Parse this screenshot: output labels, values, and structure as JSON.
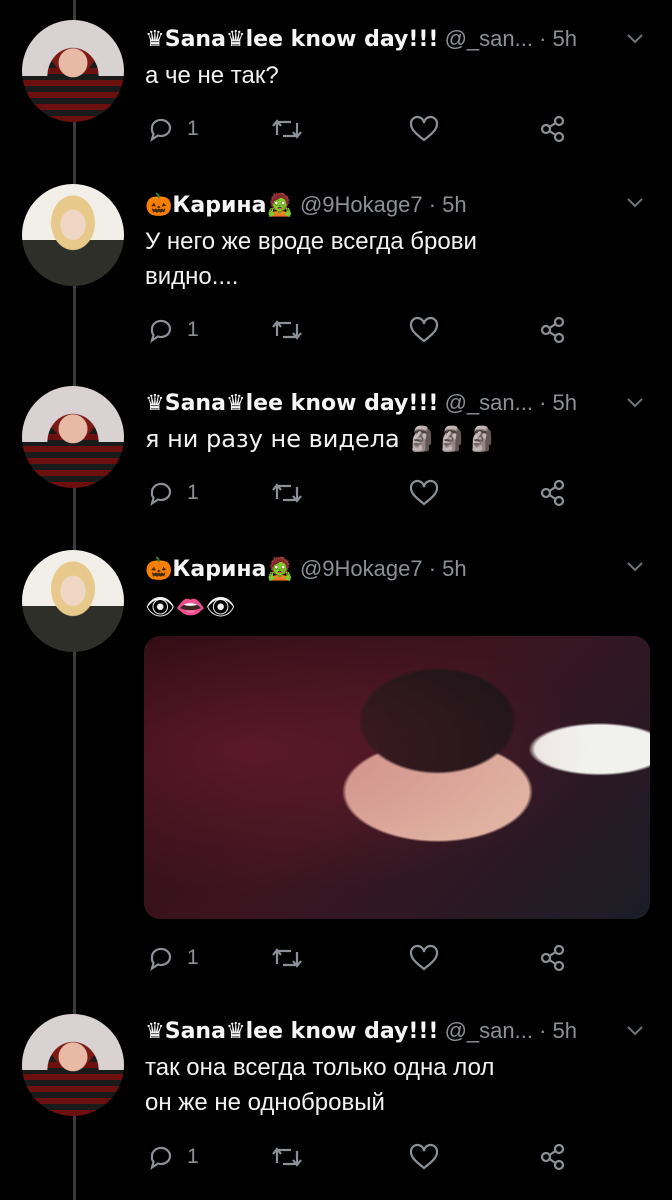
{
  "tweets": [
    {
      "author": "sana",
      "name": "♛Sana♛lee know day!!!",
      "handle": "@_san...",
      "time": "· 5h",
      "text_lines": [
        "а че не так?"
      ],
      "reply_count": "1"
    },
    {
      "author": "karina",
      "name": "🎃Карина🧟",
      "handle": "@9Hokage7",
      "time": "· 5h",
      "text_lines": [
        "У него же вроде всегда брови",
        "видно...."
      ],
      "reply_count": "1"
    },
    {
      "author": "sana",
      "name": "♛Sana♛lee know day!!!",
      "handle": "@_san...",
      "time": "· 5h",
      "text_lines": [
        "я ни разу не видела 🗿🗿🗿"
      ],
      "reply_count": "1"
    },
    {
      "author": "karina",
      "name": "🎃Карина🧟",
      "handle": "@9Hokage7",
      "time": "· 5h",
      "text_lines": [
        "👁👄👁"
      ],
      "reply_count": "1",
      "has_media": true
    },
    {
      "author": "sana",
      "name": "♛Sana♛lee know day!!!",
      "handle": "@_san...",
      "time": "· 5h",
      "text_lines": [
        "так она всегда только одна лол",
        "он же не однобровый"
      ],
      "reply_count": "1"
    }
  ],
  "icons": {
    "reply": "reply-icon",
    "retweet": "retweet-icon",
    "like": "heart-icon",
    "share": "share-icon",
    "menu": "chevron-down-icon"
  },
  "colors": {
    "background": "#000000",
    "text": "#f2f2f2",
    "muted": "#8b9197",
    "thread_line": "#3a3d40"
  }
}
